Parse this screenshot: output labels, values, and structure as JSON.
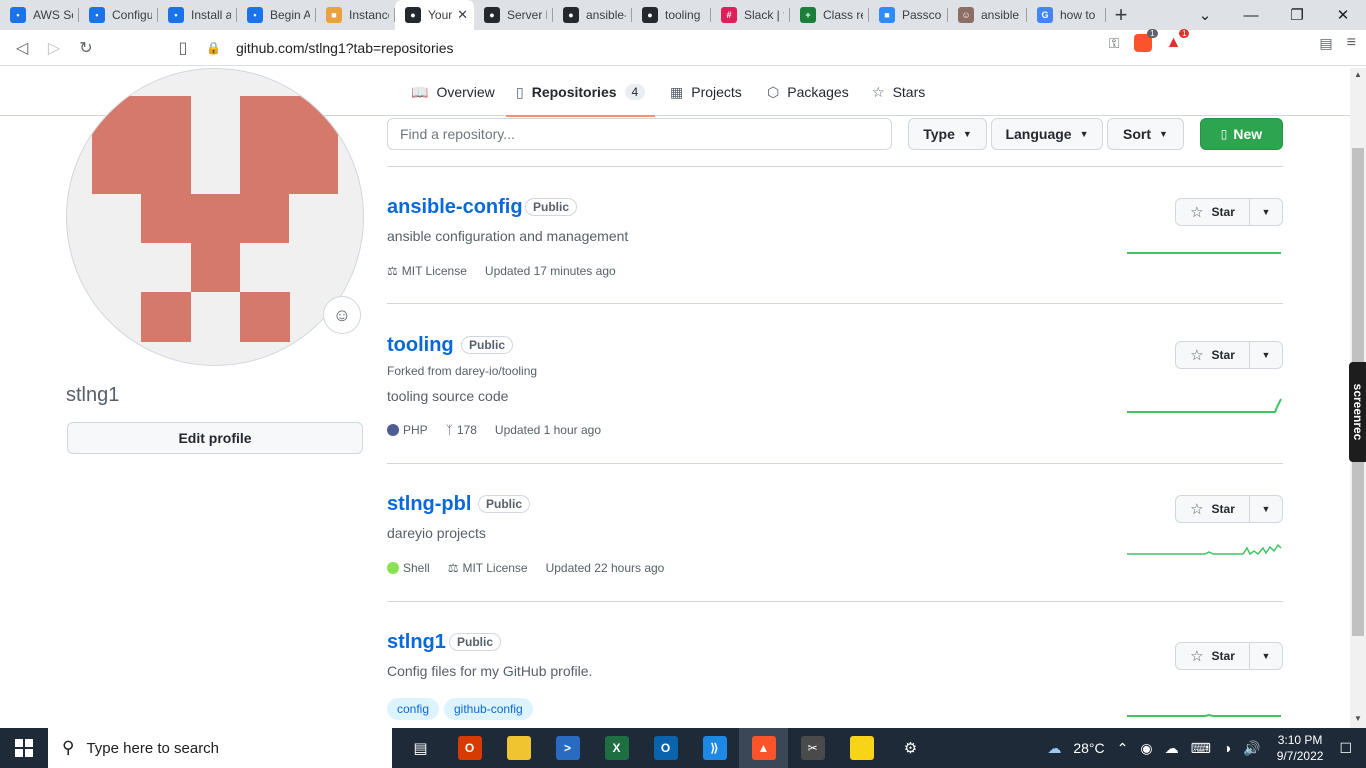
{
  "browser": {
    "tabs": [
      {
        "title": "AWS So",
        "icon": "browser-tab-doc-icon",
        "color": "#1a73e8",
        "glyph": "•"
      },
      {
        "title": "Configu",
        "icon": "browser-tab-doc-icon",
        "color": "#1a73e8",
        "glyph": "•"
      },
      {
        "title": "Install a",
        "icon": "browser-tab-doc-icon",
        "color": "#1a73e8",
        "glyph": "•"
      },
      {
        "title": "Begin A",
        "icon": "browser-tab-doc-icon",
        "color": "#1a73e8",
        "glyph": "•"
      },
      {
        "title": "Instance",
        "icon": "aws-box-icon",
        "color": "#e8a33c",
        "glyph": "■"
      },
      {
        "title": "Your",
        "icon": "github-icon",
        "color": "#24292f",
        "glyph": "●",
        "active": true
      },
      {
        "title": "Server E",
        "icon": "github-icon",
        "color": "#24292f",
        "glyph": "●"
      },
      {
        "title": "ansible-",
        "icon": "github-icon",
        "color": "#24292f",
        "glyph": "●"
      },
      {
        "title": "tooling",
        "icon": "github-icon",
        "color": "#24292f",
        "glyph": "●"
      },
      {
        "title": "Slack | t",
        "icon": "slack-icon",
        "color": "#e01e5a",
        "glyph": "#"
      },
      {
        "title": "Class re",
        "icon": "sheets-icon",
        "color": "#188038",
        "glyph": "+"
      },
      {
        "title": "Passcod",
        "icon": "zoom-icon",
        "color": "#2d8cff",
        "glyph": "■"
      },
      {
        "title": "ansible",
        "icon": "person-icon",
        "color": "#8d6e63",
        "glyph": "☺"
      },
      {
        "title": "how to",
        "icon": "google-icon",
        "color": "#4285f4",
        "glyph": "G"
      }
    ],
    "new_tab": "+",
    "url": "github.com/stlng1?tab=repositories",
    "brave_badge": "1",
    "alert_badge": "1"
  },
  "profile": {
    "username": "stlng1",
    "edit_label": "Edit profile"
  },
  "nav": {
    "overview": "Overview",
    "repositories": "Repositories",
    "repo_count": "4",
    "projects": "Projects",
    "packages": "Packages",
    "stars": "Stars"
  },
  "filters": {
    "search_placeholder": "Find a repository...",
    "type": "Type",
    "language": "Language",
    "sort": "Sort",
    "new": "New"
  },
  "repos": [
    {
      "name": "ansible-config",
      "visibility": "Public",
      "description": "ansible configuration and management",
      "license": "MIT License",
      "updated": "Updated 17 minutes ago",
      "star": "Star"
    },
    {
      "name": "tooling",
      "visibility": "Public",
      "forked_from": "Forked from darey-io/tooling",
      "description": "tooling source code",
      "language": "PHP",
      "language_color": "#4f5d95",
      "forks": "178",
      "updated": "Updated 1 hour ago",
      "star": "Star"
    },
    {
      "name": "stlng-pbl",
      "visibility": "Public",
      "description": "dareyio projects",
      "language": "Shell",
      "language_color": "#89e051",
      "license": "MIT License",
      "updated": "Updated 22 hours ago",
      "star": "Star"
    },
    {
      "name": "stlng1",
      "visibility": "Public",
      "description": "Config files for my GitHub profile.",
      "topics": [
        "config",
        "github-config"
      ],
      "star": "Star"
    }
  ],
  "overlay": {
    "screenrec": "screenrec"
  },
  "taskbar": {
    "search_placeholder": "Type here to search",
    "temperature": "28°C",
    "time": "3:10 PM",
    "date": "9/7/2022"
  }
}
